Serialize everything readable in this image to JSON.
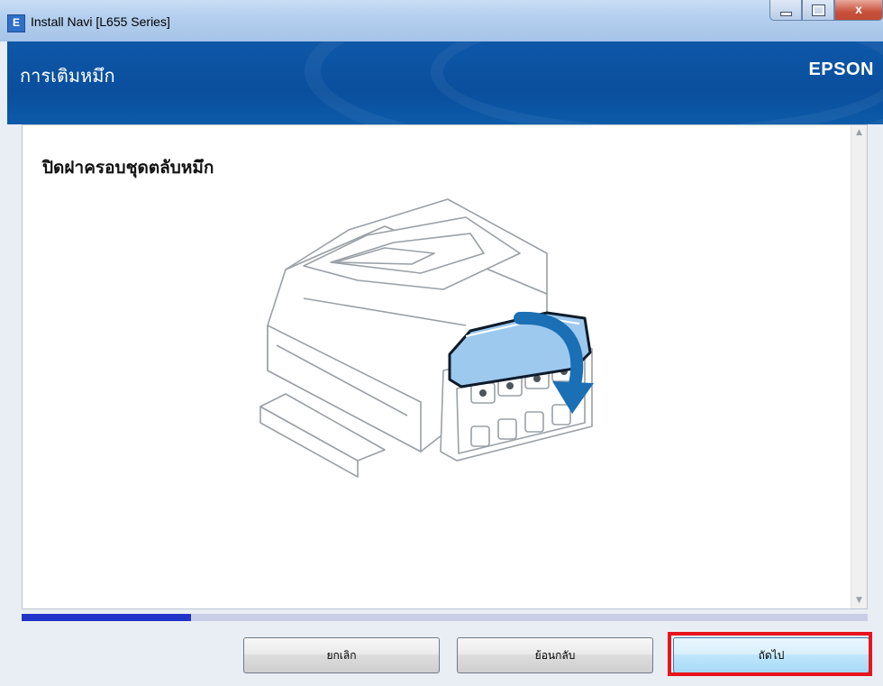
{
  "window": {
    "title": "Install Navi [L655 Series]",
    "app_icon_letter": "E",
    "close_glyph": "x"
  },
  "header": {
    "title": "การเติมหมึก",
    "brand": "EPSON"
  },
  "content": {
    "heading": "ปิดฝาครอบชุดตลับหมึก",
    "illustration_icon": "printer-close-ink-cover-illustration"
  },
  "progress": {
    "value_fraction": 0.2,
    "color": "#2034c9"
  },
  "buttons": {
    "cancel": "ยกเลิก",
    "back": "ย้อนกลับ",
    "next": "ถัดไป"
  },
  "colors": {
    "header_blue": "#0c5aa9",
    "highlight_red": "#e8141c",
    "cover_blue": "#9ec9ee"
  }
}
